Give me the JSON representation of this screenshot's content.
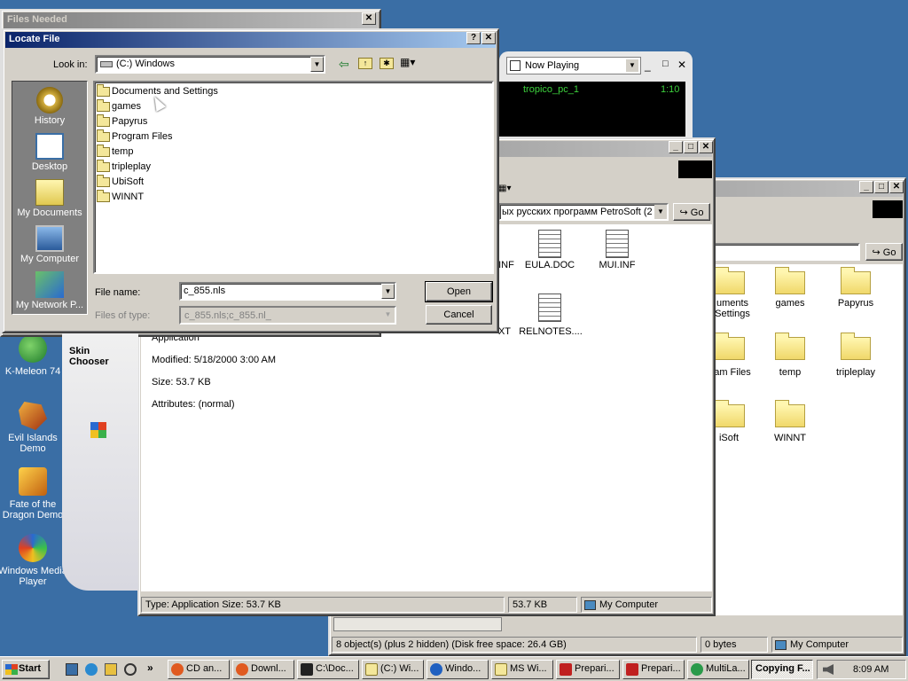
{
  "desktop": {
    "icons": [
      {
        "label": "K-Meleon 74",
        "color": "#2a9d3a"
      },
      {
        "label": "Evil Islands Demo",
        "color": "#c0601a"
      },
      {
        "label": "Fate of the Dragon Demo",
        "color": "#e0a020"
      },
      {
        "label": "Windows Media Player",
        "color": "#2060c0"
      }
    ]
  },
  "files_needed": {
    "title": "Files Needed"
  },
  "media_player": {
    "now_playing": "Now Playing",
    "track": "tropico_pc_1",
    "time": "1:10"
  },
  "skin_chooser": {
    "label": "Skin Chooser",
    "details": {
      "type": "Application",
      "modified": "Modified: 5/18/2000 3:00 AM",
      "size": "Size: 53.7 KB",
      "attributes": "Attributes: (normal)"
    }
  },
  "explorer_mid": {
    "address": "ых русских программ PetroSoft (2",
    "go_label": "Go",
    "files": [
      {
        "name": "INF",
        "type": "doc"
      },
      {
        "name": "EULA.DOC",
        "type": "doc"
      },
      {
        "name": "MUI.INF",
        "type": "doc"
      },
      {
        "name": "XT",
        "type": "doc"
      },
      {
        "name": "RELNOTES....",
        "type": "doc"
      }
    ],
    "status": {
      "type_size": "Type: Application Size: 53.7 KB",
      "size": "53.7 KB",
      "zone": "My Computer"
    }
  },
  "explorer_right": {
    "go_label": "Go",
    "folders": [
      "uments Settings",
      "games",
      "Papyrus",
      "am Files",
      "temp",
      "tripleplay",
      "iSoft",
      "WINNT"
    ],
    "status": {
      "objects": "8 object(s) (plus 2 hidden) (Disk free space: 26.4 GB)",
      "bytes": "0 bytes",
      "zone": "My Computer"
    }
  },
  "locate_file": {
    "title": "Locate File",
    "help": "?",
    "close": "✕",
    "look_in_label": "Look in:",
    "look_in_value": "(C:) Windows",
    "places": [
      "History",
      "Desktop",
      "My Documents",
      "My Computer",
      "My Network P..."
    ],
    "files": [
      "Documents and Settings",
      "games",
      "Papyrus",
      "Program Files",
      "temp",
      "tripleplay",
      "UbiSoft",
      "WINNT"
    ],
    "file_name_label": "File name:",
    "file_name_value": "c_855.nls",
    "files_of_type_label": "Files of type:",
    "files_of_type_value": "c_855.nls;c_855.nl_",
    "open_label": "Open",
    "cancel_label": "Cancel"
  },
  "taskbar": {
    "start": "Start",
    "tasks": [
      "CD an...",
      "Downl...",
      "C:\\Doc...",
      "(C:) Wi...",
      "Windo...",
      "MS Wi...",
      "Prepari...",
      "Prepari...",
      "MultiLa...",
      "Copying F..."
    ],
    "clock": "8:09 AM"
  }
}
